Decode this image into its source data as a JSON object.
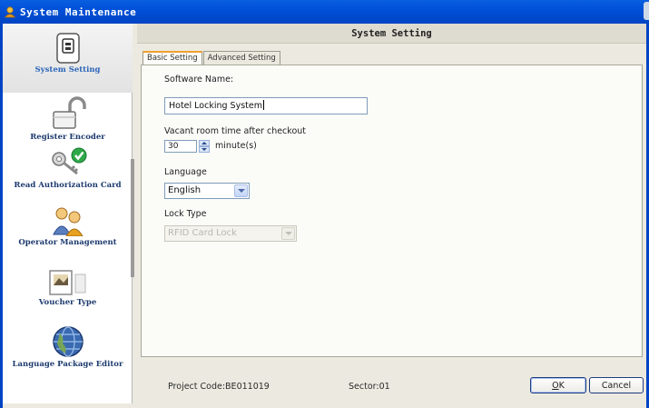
{
  "window": {
    "title": "System Maintenance"
  },
  "sidebar": {
    "items": [
      {
        "label": "System Setting",
        "icon": "phone-icon"
      },
      {
        "label": "Register Encoder",
        "icon": "padlock-icon"
      },
      {
        "label": "Read Authorization Card",
        "icon": "keys-check-icon"
      },
      {
        "label": "Operator Management",
        "icon": "operators-icon"
      },
      {
        "label": "Voucher Type",
        "icon": "voucher-icon"
      },
      {
        "label": "Language Package Editor",
        "icon": "globe-icon"
      }
    ]
  },
  "header": {
    "title": "System Setting"
  },
  "tabs": [
    {
      "label": "Basic Setting"
    },
    {
      "label": "Advanced Setting"
    }
  ],
  "form": {
    "software_name": {
      "label": "Software Name:",
      "value": "Hotel Locking System"
    },
    "vacant_time": {
      "label": "Vacant room time after checkout",
      "value": "30",
      "unit": "minute(s)"
    },
    "language": {
      "label": "Language",
      "value": "English"
    },
    "lock_type": {
      "label": "Lock Type",
      "value": "RFID Card Lock"
    }
  },
  "status_bar": {
    "project_code": "Project Code:BE011019",
    "sector": "Sector:01",
    "ok_label": "OK",
    "ok_rest": "K",
    "ok_mnemonic": "O",
    "cancel_label": "Cancel"
  },
  "colors": {
    "title_bar": "#0050d8",
    "selected_label": "#2a64b8",
    "label": "#1c3a6e"
  }
}
